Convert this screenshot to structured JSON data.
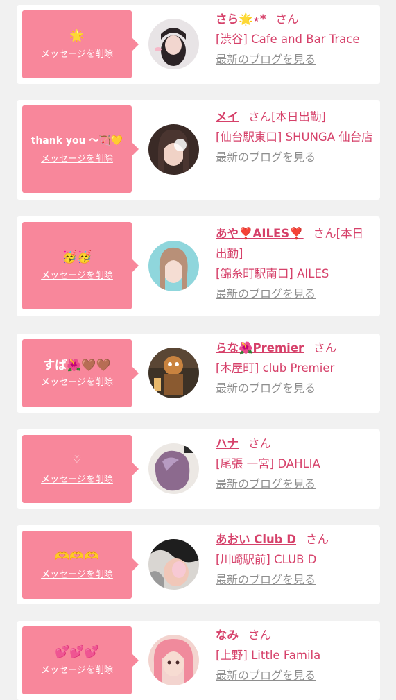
{
  "cards": [
    {
      "message": "🌟",
      "delete_label": "メッセージを削除",
      "name": "さら🌟⋆*",
      "honorific": "さん",
      "status": "",
      "shop": "[渋谷] Cafe and Bar Trace",
      "blog_link": "最新のブログを見る"
    },
    {
      "message": "thank you 〜🏹💛",
      "delete_label": "メッセージを削除",
      "name": "メイ",
      "honorific": "さん",
      "status": "[本日出勤]",
      "shop": "[仙台駅東口] SHUNGA 仙台店",
      "blog_link": "最新のブログを見る"
    },
    {
      "message": "🥳🥳",
      "delete_label": "メッセージを削除",
      "name": "あや❣️AILES❣️",
      "honorific": "さん",
      "status": "[本日出勤]",
      "shop": "[錦糸町駅南口] AILES",
      "blog_link": "最新のブログを見る"
    },
    {
      "message": "すぱ🌺🤎🤎",
      "delete_label": "メッセージを削除",
      "name": "らな🌺Premier",
      "honorific": "さん",
      "status": "",
      "shop": "[木屋町] club Premier",
      "blog_link": "最新のブログを見る"
    },
    {
      "message": "♡",
      "delete_label": "メッセージを削除",
      "name": "ハナ",
      "honorific": "さん",
      "status": "",
      "shop": "[尾張 一宮] DAHLIA",
      "blog_link": "最新のブログを見る"
    },
    {
      "message": "🫶🫶🫶",
      "delete_label": "メッセージを削除",
      "name": "あおい Club D",
      "honorific": "さん",
      "status": "",
      "shop": "[川崎駅前] CLUB D",
      "blog_link": "最新のブログを見る"
    },
    {
      "message": "💕💕💕",
      "delete_label": "メッセージを削除",
      "name": "なみ",
      "honorific": "さん",
      "status": "",
      "shop": "[上野] Little Famila",
      "blog_link": "最新のブログを見る"
    }
  ],
  "colors": {
    "background": "#f1f1f1",
    "card": "#ffffff",
    "bubble": "#f8879b",
    "name_text": "#d6416a",
    "link_grey": "#8e8e8e"
  }
}
